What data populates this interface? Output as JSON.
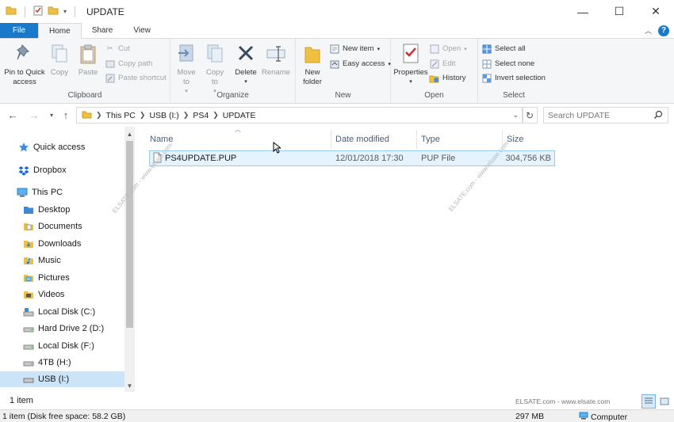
{
  "window": {
    "title": "UPDATE",
    "minimize_glyph": "—",
    "maximize_glyph": "☐",
    "close_glyph": "✕"
  },
  "ribbon_tabs": [
    {
      "label": "File"
    },
    {
      "label": "Home"
    },
    {
      "label": "Share"
    },
    {
      "label": "View"
    }
  ],
  "ribbon": {
    "clipboard": {
      "label": "Clipboard",
      "pin": "Pin to Quick access",
      "copy": "Copy",
      "paste": "Paste",
      "cut": "Cut",
      "copy_path": "Copy path",
      "paste_shortcut": "Paste shortcut"
    },
    "organize": {
      "label": "Organize",
      "move_to": "Move to",
      "copy_to": "Copy to",
      "delete": "Delete",
      "rename": "Rename"
    },
    "new": {
      "label": "New",
      "new_folder": "New folder",
      "new_item": "New item",
      "easy_access": "Easy access"
    },
    "open": {
      "label": "Open",
      "properties": "Properties",
      "open": "Open",
      "edit": "Edit",
      "history": "History"
    },
    "select": {
      "label": "Select",
      "select_all": "Select all",
      "select_none": "Select none",
      "invert": "Invert selection"
    }
  },
  "address": {
    "crumbs": [
      "This PC",
      "USB (I:)",
      "PS4",
      "UPDATE"
    ]
  },
  "search": {
    "placeholder": "Search UPDATE"
  },
  "nav": {
    "items": [
      {
        "label": "Quick access",
        "icon": "star-icon"
      },
      {
        "label": "Dropbox",
        "icon": "dropbox-icon"
      },
      {
        "label": "This PC",
        "icon": "computer-icon"
      },
      {
        "label": "Desktop",
        "icon": "folder-icon"
      },
      {
        "label": "Documents",
        "icon": "folder-icon"
      },
      {
        "label": "Downloads",
        "icon": "folder-icon"
      },
      {
        "label": "Music",
        "icon": "folder-icon"
      },
      {
        "label": "Pictures",
        "icon": "folder-icon"
      },
      {
        "label": "Videos",
        "icon": "folder-icon"
      },
      {
        "label": "Local Disk (C:)",
        "icon": "drive-icon"
      },
      {
        "label": "Hard Drive 2 (D:)",
        "icon": "drive-icon"
      },
      {
        "label": "Local Disk (F:)",
        "icon": "drive-icon"
      },
      {
        "label": "4TB (H:)",
        "icon": "drive-icon"
      },
      {
        "label": "USB (I:)",
        "icon": "usb-drive-icon"
      }
    ]
  },
  "columns": {
    "name": "Name",
    "date": "Date modified",
    "type": "Type",
    "size": "Size"
  },
  "files": [
    {
      "name": "PS4UPDATE.PUP",
      "date": "12/01/2018 17:30",
      "type": "PUP File",
      "size": "304,756 KB"
    }
  ],
  "watermarks": {
    "left": "ELSATE.com - www.elsate.com",
    "middle": "ELSATE.com - www.elsate.com",
    "bottom": "ELSATE.com - www.elsate.com"
  },
  "status": {
    "item_count": "1 item",
    "bottom_left": "1 item (Disk free space: 58.2 GB)",
    "bottom_size": "297 MB",
    "bottom_location": "Computer"
  },
  "colors": {
    "accent": "#1979ca",
    "selection": "#cce4f7",
    "folder": "#f0c040"
  }
}
